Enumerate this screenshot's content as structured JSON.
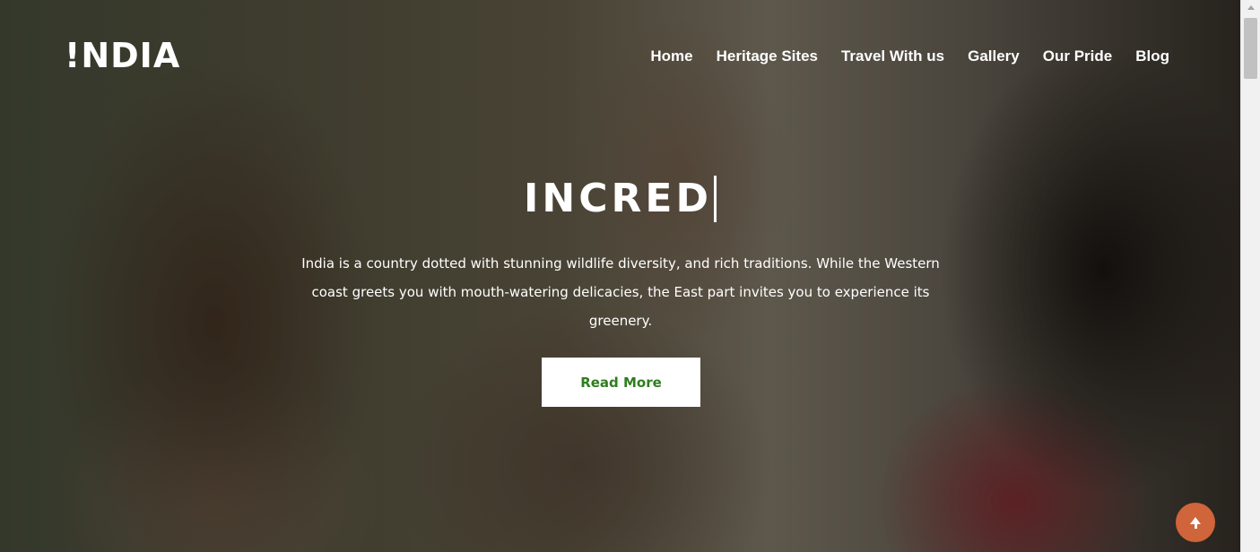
{
  "logo": {
    "text": "!NDIA"
  },
  "nav": {
    "items": [
      {
        "label": "Home"
      },
      {
        "label": "Heritage Sites"
      },
      {
        "label": "Travel With us"
      },
      {
        "label": "Gallery"
      },
      {
        "label": "Our Pride"
      },
      {
        "label": "Blog"
      }
    ]
  },
  "hero": {
    "headline": "INCRED",
    "description": "India is a country dotted with stunning wildlife diversity, and rich traditions. While the Western coast greets you with mouth-watering delicacies, the East part invites you to experience its greenery.",
    "button_label": "Read More"
  },
  "back_to_top": {
    "icon": "arrow-up-icon"
  },
  "colors": {
    "accent_button_text": "#2e7d1e",
    "back_to_top_bg": "#d0643a"
  }
}
